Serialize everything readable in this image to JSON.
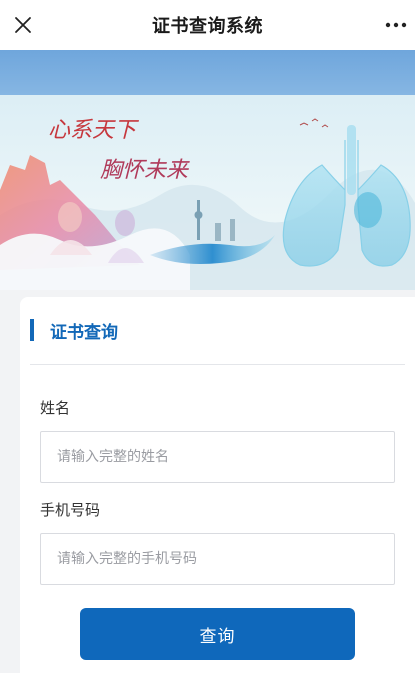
{
  "header": {
    "title": "证书查询系统"
  },
  "banner": {
    "slogan_line1": "心系天下",
    "slogan_line2": "胸怀未来"
  },
  "form": {
    "section_title": "证书查询",
    "name_label": "姓名",
    "name_placeholder": "请输入完整的姓名",
    "phone_label": "手机号码",
    "phone_placeholder": "请输入完整的手机号码",
    "submit_label": "查询"
  },
  "colors": {
    "accent": "#1268b8",
    "button": "#0f68bb",
    "strip": "#7aaedf"
  }
}
